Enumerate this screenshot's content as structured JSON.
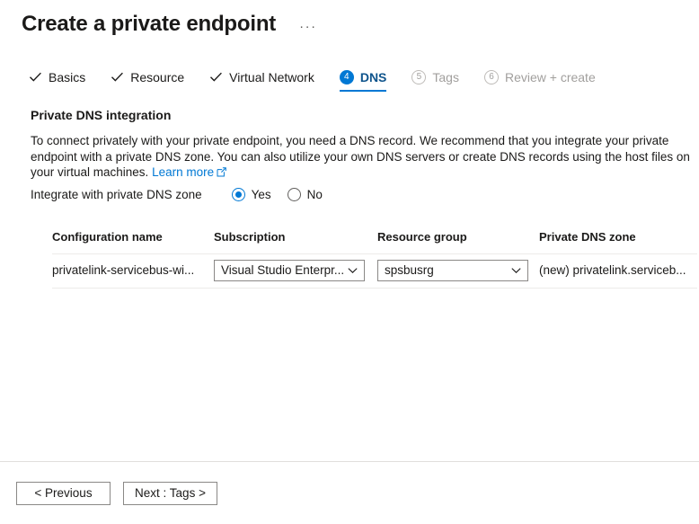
{
  "header": {
    "title": "Create a private endpoint",
    "more_menu": "···"
  },
  "wizard": {
    "tabs": [
      {
        "label": "Basics",
        "state": "done",
        "marker": "check"
      },
      {
        "label": "Resource",
        "state": "done",
        "marker": "check"
      },
      {
        "label": "Virtual Network",
        "state": "done",
        "marker": "check"
      },
      {
        "label": "DNS",
        "state": "active",
        "marker": "4"
      },
      {
        "label": "Tags",
        "state": "disabled",
        "marker": "5"
      },
      {
        "label": "Review + create",
        "state": "disabled",
        "marker": "6"
      }
    ]
  },
  "section": {
    "title": "Private DNS integration",
    "description": "To connect privately with your private endpoint, you need a DNS record. We recommend that you integrate your private endpoint with a private DNS zone. You can also utilize your own DNS servers or create DNS records using the host files on your virtual machines.",
    "learn_more": "Learn more"
  },
  "integrate": {
    "label": "Integrate with private DNS zone",
    "selected": "Yes",
    "options": [
      "Yes",
      "No"
    ]
  },
  "table": {
    "headers": {
      "configuration_name": "Configuration name",
      "subscription": "Subscription",
      "resource_group": "Resource group",
      "private_dns_zone": "Private DNS zone"
    },
    "rows": [
      {
        "configuration_name": "privatelink-servicebus-wi...",
        "subscription": "Visual Studio Enterpr...",
        "resource_group": "spsbusrg",
        "private_dns_zone": "(new) privatelink.serviceb..."
      }
    ]
  },
  "footer": {
    "previous": "< Previous",
    "next": "Next : Tags >"
  },
  "colors": {
    "accent": "#0078d4",
    "active_tab_text": "#0f548c",
    "disabled_text": "#a19f9d",
    "text": "#1b1a19",
    "border": "#8a8886",
    "divider": "#e1dfdd"
  }
}
